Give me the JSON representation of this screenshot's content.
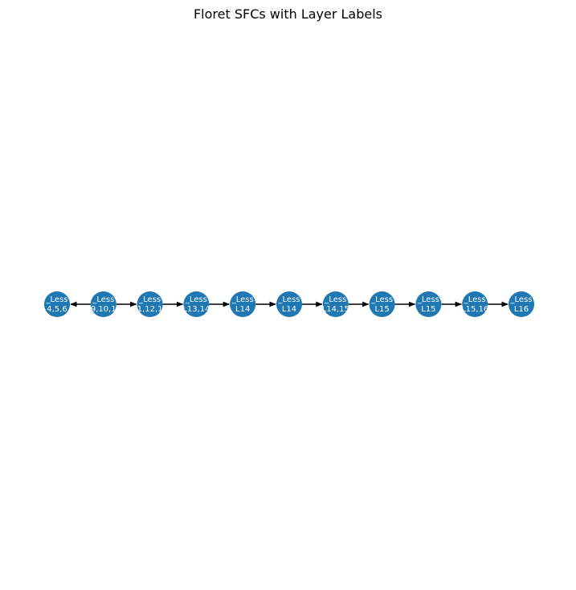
{
  "title": "Floret SFCs with Layer Labels",
  "colors": {
    "node": "#1f77b4",
    "edge": "#000000",
    "label": "#ffffff"
  },
  "nodes": [
    {
      "line1": "_Less",
      "line2": "4,5,6"
    },
    {
      "line1": "_Less",
      "line2": "9,10,1"
    },
    {
      "line1": "_Less",
      "line2": "1,12,1"
    },
    {
      "line1": "_Less",
      "line2": "L13,14"
    },
    {
      "line1": "_Less",
      "line2": "L14"
    },
    {
      "line1": "_Less",
      "line2": "L14"
    },
    {
      "line1": "_Less",
      "line2": "L14,15"
    },
    {
      "line1": "_Less",
      "line2": "L15"
    },
    {
      "line1": "_Less",
      "line2": "L15"
    },
    {
      "line1": "_Less",
      "line2": "L15,16"
    },
    {
      "line1": "_Less",
      "line2": "L16"
    }
  ],
  "edges": [
    {
      "from": 1,
      "to": 0
    },
    {
      "from": 1,
      "to": 2
    },
    {
      "from": 2,
      "to": 3
    },
    {
      "from": 3,
      "to": 4
    },
    {
      "from": 4,
      "to": 5
    },
    {
      "from": 5,
      "to": 6
    },
    {
      "from": 6,
      "to": 7
    },
    {
      "from": 7,
      "to": 8
    },
    {
      "from": 8,
      "to": 9
    },
    {
      "from": 9,
      "to": 10
    }
  ]
}
